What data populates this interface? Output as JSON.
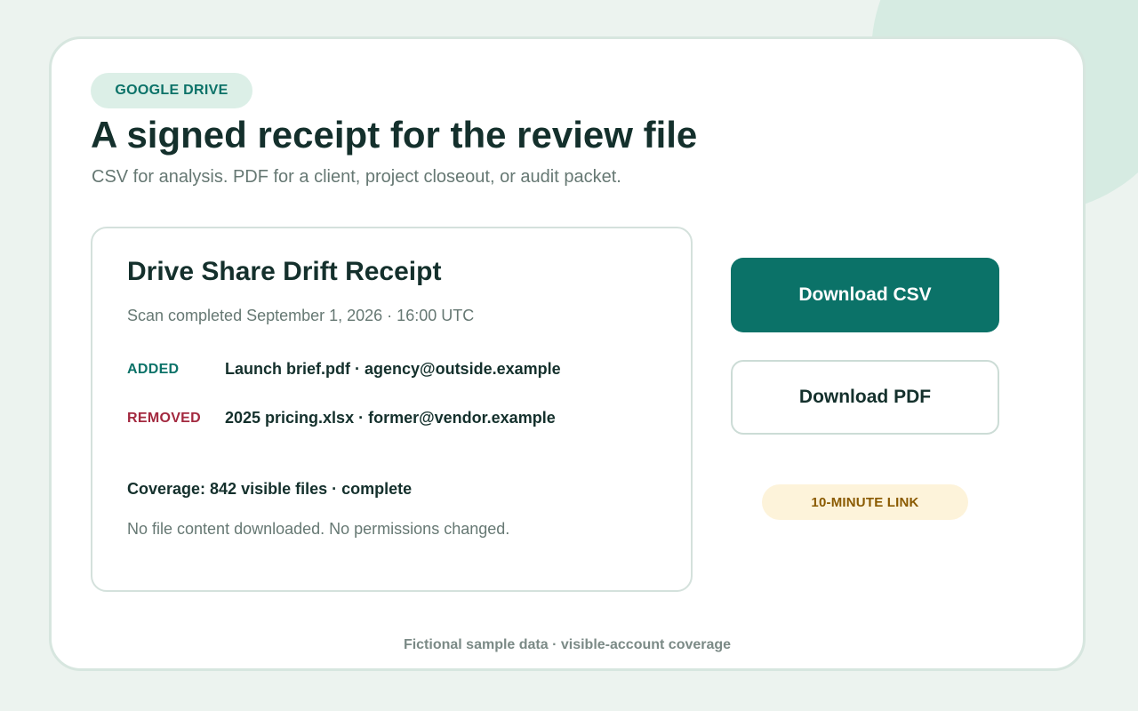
{
  "header": {
    "badge": "GOOGLE DRIVE",
    "title": "A signed receipt for the review file",
    "subtitle": "CSV for analysis. PDF for a client, project closeout, or audit packet."
  },
  "receipt": {
    "title": "Drive Share Drift Receipt",
    "scan_completed": "Scan completed September 1, 2026 · 16:00 UTC",
    "changes": [
      {
        "kind": "ADDED",
        "detail": "Launch brief.pdf · agency@outside.example"
      },
      {
        "kind": "REMOVED",
        "detail": "2025 pricing.xlsx · former@vendor.example"
      }
    ],
    "coverage": "Coverage: 842 visible files · complete",
    "note": "No file content downloaded. No permissions changed."
  },
  "actions": {
    "csv_label": "Download CSV",
    "pdf_label": "Download PDF",
    "link_badge": "10-MINUTE LINK"
  },
  "footer": {
    "note": "Fictional sample data · visible-account coverage"
  },
  "colors": {
    "accent": "#0b7268",
    "removed": "#a3293f",
    "badge_bg": "#dcefe7",
    "warning_bg": "#fdf3da",
    "warning_text": "#8a5a00"
  }
}
